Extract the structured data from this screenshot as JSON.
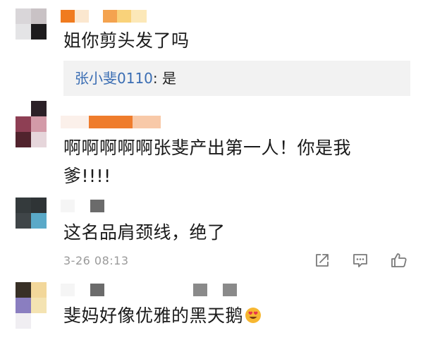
{
  "comments": [
    {
      "text": "姐你剪头发了吗",
      "reply": {
        "author": "张小斐0110",
        "separator": ": ",
        "text": "是"
      }
    },
    {
      "line1": "啊啊啊啊啊张斐产出第一人！你是我",
      "line2": "爹!!!!"
    },
    {
      "text": "这名品肩颈线，绝了",
      "time": "3-26 08:13"
    },
    {
      "text": "斐妈好像优雅的黑天鹅"
    }
  ],
  "actions": {
    "share_icon": "share-icon",
    "comment_icon": "comment-icon",
    "like_icon": "like-icon"
  },
  "colors": {
    "reply_author": "#3a6db3",
    "reply_bg": "#f2f2f2",
    "time": "#9a9a9a"
  }
}
